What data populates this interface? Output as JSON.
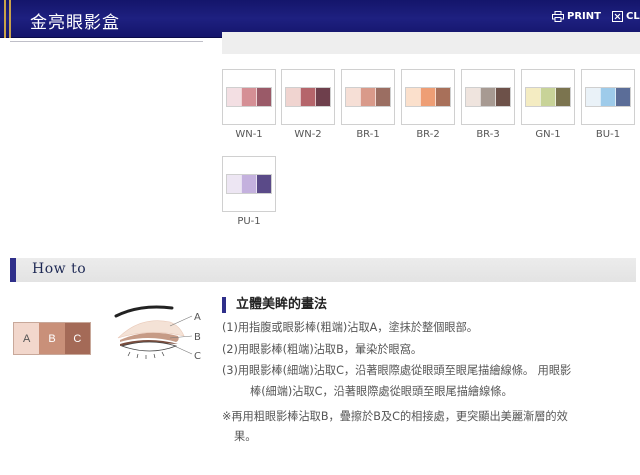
{
  "header": {
    "title": "金亮眼影盒",
    "print_label": "PRINT",
    "close_label": "CL"
  },
  "colors": {
    "header_bg": "#1e2080",
    "accent_gold": "#c9a24a",
    "section_bar": "#2f2f8a"
  },
  "shades": [
    {
      "name": "WN-1",
      "colors": [
        "#f3dfe3",
        "#d58f95",
        "#9a5a68"
      ]
    },
    {
      "name": "WN-2",
      "colors": [
        "#f0d4d0",
        "#b5656b",
        "#6e3f4c"
      ]
    },
    {
      "name": "BR-1",
      "colors": [
        "#f6dfd6",
        "#d99a8a",
        "#9b6e62"
      ]
    },
    {
      "name": "BR-2",
      "colors": [
        "#fbe0cc",
        "#ee9e75",
        "#a8705a"
      ]
    },
    {
      "name": "BR-3",
      "colors": [
        "#efe4de",
        "#a79a92",
        "#6d5149"
      ]
    },
    {
      "name": "GN-1",
      "colors": [
        "#f4ecc2",
        "#c8d398",
        "#7b744f"
      ]
    },
    {
      "name": "BU-1",
      "colors": [
        "#eaf2f8",
        "#9ecbea",
        "#5b6d98"
      ]
    },
    {
      "name": "PU-1",
      "colors": [
        "#ede6f3",
        "#c4b1de",
        "#5a4a88"
      ]
    }
  ],
  "section": {
    "howto_label": "How to"
  },
  "abc_palette": {
    "labels": [
      "A",
      "B",
      "C"
    ],
    "colors": [
      "#f2d7cc",
      "#c99079",
      "#a46a57"
    ]
  },
  "eye_labels": [
    "A",
    "B",
    "C"
  ],
  "instructions": {
    "title": "立體美眸的畫法",
    "steps": [
      "(1)用指腹或眼影棒(粗端)沾取A，塗抹於整個眼部。",
      "(2)用眼影棒(粗端)沾取B，暈染於眼窩。",
      "(3)用眼影棒(細端)沾取C，沿著眼際處從眼頭至眼尾描繪線條。 用眼影",
      "棒(細端)沾取C，沿著眼際處從眼頭至眼尾描繪線條。",
      "※再用粗眼影棒沾取B，疊擦於B及C的相接處，更突顯出美麗漸層的效",
      "果。"
    ]
  }
}
